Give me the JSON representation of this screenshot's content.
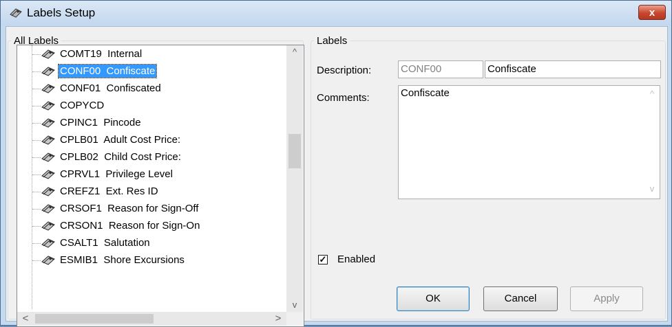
{
  "window": {
    "title": "Labels Setup",
    "close_glyph": "x"
  },
  "all_labels": {
    "legend": "All Labels",
    "items": [
      {
        "code": "COMT19",
        "name": "Internal",
        "selected": false
      },
      {
        "code": "CONF00",
        "name": "Confiscate",
        "selected": true
      },
      {
        "code": "CONF01",
        "name": "Confiscated",
        "selected": false
      },
      {
        "code": "COPYCD",
        "name": "",
        "selected": false
      },
      {
        "code": "CPINC1",
        "name": "Pincode",
        "selected": false
      },
      {
        "code": "CPLB01",
        "name": "Adult Cost Price:",
        "selected": false
      },
      {
        "code": "CPLB02",
        "name": "Child Cost Price:",
        "selected": false
      },
      {
        "code": "CPRVL1",
        "name": "Privilege Level",
        "selected": false
      },
      {
        "code": "CREFZ1",
        "name": "Ext. Res ID",
        "selected": false
      },
      {
        "code": "CRSOF1",
        "name": "Reason for Sign-Off",
        "selected": false
      },
      {
        "code": "CRSON1",
        "name": "Reason for Sign-On",
        "selected": false
      },
      {
        "code": "CSALT1",
        "name": "Salutation",
        "selected": false
      },
      {
        "code": "ESMIB1",
        "name": "Shore Excursions",
        "selected": false
      }
    ],
    "item_labels": [
      "COMT19  Internal",
      "CONF00  Confiscate",
      "CONF01  Confiscated",
      "COPYCD",
      "CPINC1  Pincode",
      "CPLB01  Adult Cost Price:",
      "CPLB02  Child Cost Price:",
      "CPRVL1  Privilege Level",
      "CREFZ1  Ext. Res ID",
      "CRSOF1  Reason for Sign-Off",
      "CRSON1  Reason for Sign-On",
      "CSALT1  Salutation",
      "ESMIB1  Shore Excursions"
    ],
    "scroll_up": "^",
    "scroll_down": "v",
    "scroll_left": "<",
    "scroll_right": ">"
  },
  "labels_panel": {
    "legend": "Labels",
    "description_label": "Description:",
    "description_code": "CONF00",
    "description_value": "Confiscate",
    "comments_label": "Comments:",
    "comments_value": "Confiscate",
    "enabled_label": "Enabled",
    "enabled_checked": true,
    "check_glyph": "✓"
  },
  "buttons": {
    "ok": "OK",
    "cancel": "Cancel",
    "apply": "Apply"
  },
  "colors": {
    "selection": "#3399ff",
    "close_button": "#c9462e"
  },
  "icons": {
    "window": "labels-icon",
    "tree_item": "labels-icon"
  }
}
